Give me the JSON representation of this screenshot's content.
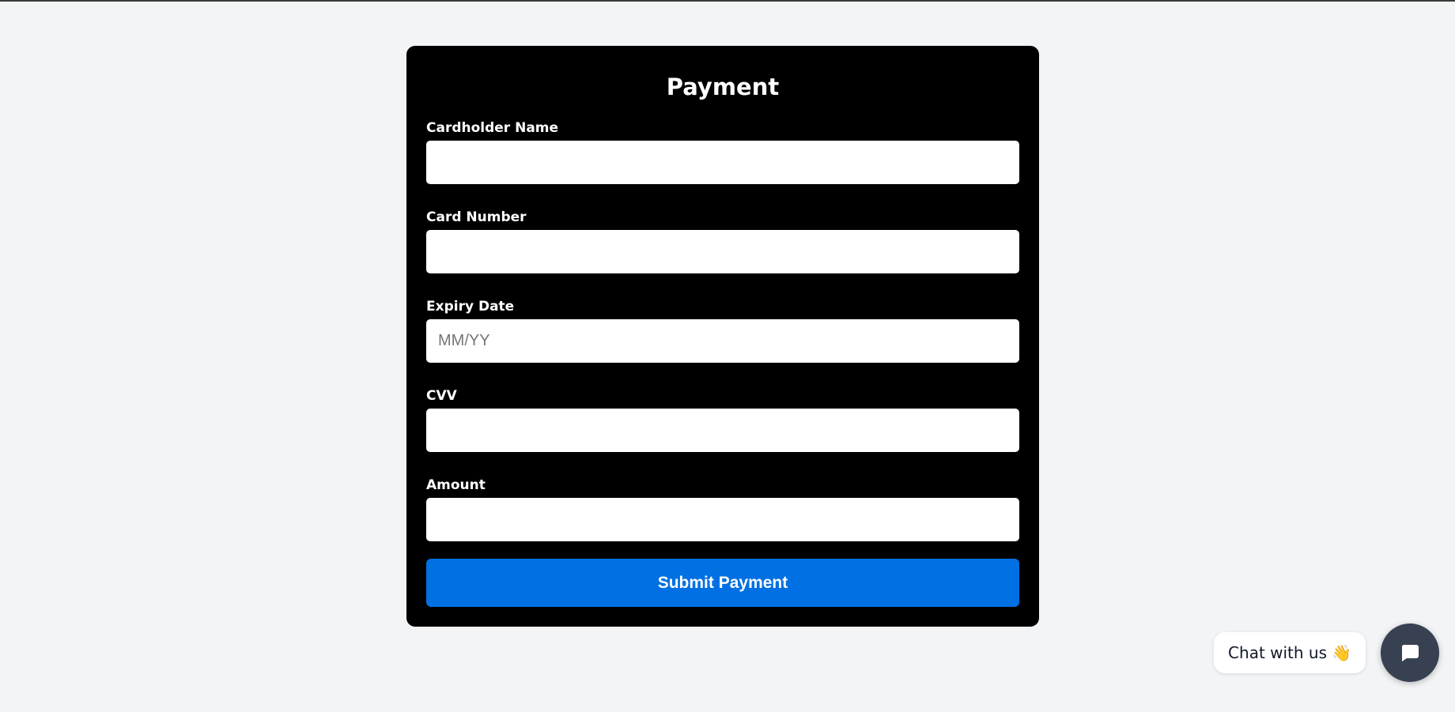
{
  "form": {
    "title": "Payment",
    "fields": [
      {
        "label": "Cardholder Name",
        "value": "",
        "placeholder": ""
      },
      {
        "label": "Card Number",
        "value": "",
        "placeholder": ""
      },
      {
        "label": "Expiry Date",
        "value": "",
        "placeholder": "MM/YY"
      },
      {
        "label": "CVV",
        "value": "",
        "placeholder": ""
      },
      {
        "label": "Amount",
        "value": "",
        "placeholder": ""
      }
    ],
    "submit_label": "Submit Payment"
  },
  "chat": {
    "label": "Chat with us",
    "emoji": "👋",
    "button_icon": "chat-bubble-icon"
  },
  "colors": {
    "page_background": "#f3f4f6",
    "card_background": "#000000",
    "submit_button": "#0070e2",
    "chat_fab": "#374151"
  }
}
